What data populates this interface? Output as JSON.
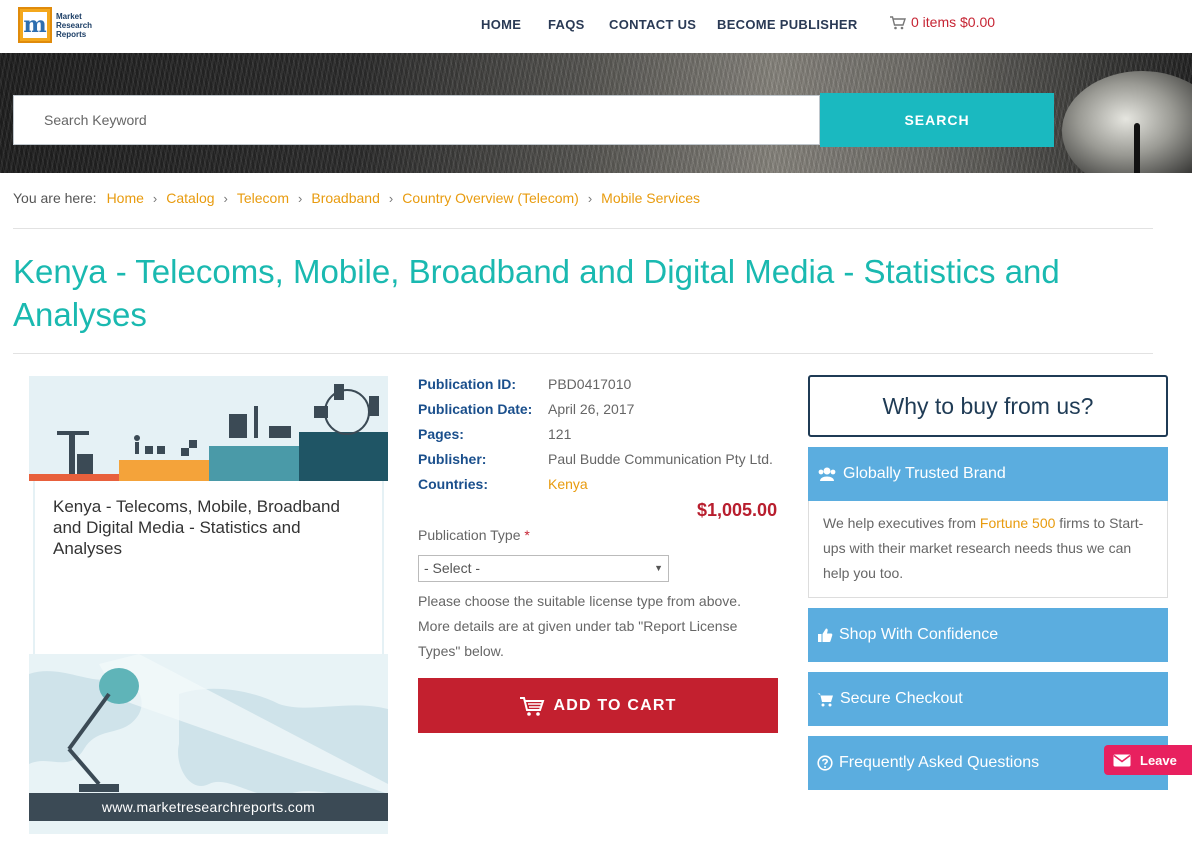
{
  "header": {
    "logo_lines": [
      "Market",
      "Research",
      "Reports"
    ],
    "nav": [
      "HOME",
      "FAQS",
      "CONTACT US",
      "BECOME PUBLISHER"
    ],
    "cart_label": "0 items $0.00"
  },
  "search": {
    "placeholder": "Search Keyword",
    "button": "SEARCH"
  },
  "breadcrumb": {
    "label": "You are here:",
    "items": [
      "Home",
      "Catalog",
      "Telecom",
      "Broadband",
      "Country Overview (Telecom)",
      "Mobile Services"
    ]
  },
  "title": "Kenya - Telecoms, Mobile, Broadband and Digital Media - Statistics and Analyses",
  "cover": {
    "title": "Kenya - Telecoms, Mobile, Broadband and Digital Media - Statistics and Analyses",
    "url": "www.marketresearchreports.com"
  },
  "details": {
    "rows": [
      {
        "label": "Publication ID:",
        "value": "PBD0417010"
      },
      {
        "label": "Publication Date:",
        "value": "April 26, 2017"
      },
      {
        "label": "Pages:",
        "value": "121"
      },
      {
        "label": "Publisher:",
        "value": "Paul Budde Communication Pty Ltd."
      },
      {
        "label": "Countries:",
        "value": "Kenya"
      }
    ],
    "price": "$1,005.00",
    "pub_type_label": "Publication Type",
    "required_mark": "*",
    "select_value": "- Select -",
    "help_text": "Please choose the suitable license type from above. More details are at given under tab \"Report License Types\" below.",
    "add_to_cart": "ADD TO CART"
  },
  "sidebar": {
    "why": "Why to buy from us?",
    "trusted": "Globally Trusted Brand",
    "trusted_body_pre": "We help executives from ",
    "trusted_body_hl": "Fortune 500",
    "trusted_body_post": " firms to Start-ups with their market research needs thus we can help you too.",
    "shop": "Shop With Confidence",
    "secure": "Secure Checkout",
    "faq": "Frequently Asked Questions"
  },
  "leave": "Leave",
  "colors": {
    "accent_teal": "#1ab9c0",
    "title_teal": "#1ab9b0",
    "link_orange": "#e89b0e",
    "cart_red": "#c3202f",
    "sidebar_blue": "#5baddf",
    "label_blue": "#1a4f8c"
  }
}
